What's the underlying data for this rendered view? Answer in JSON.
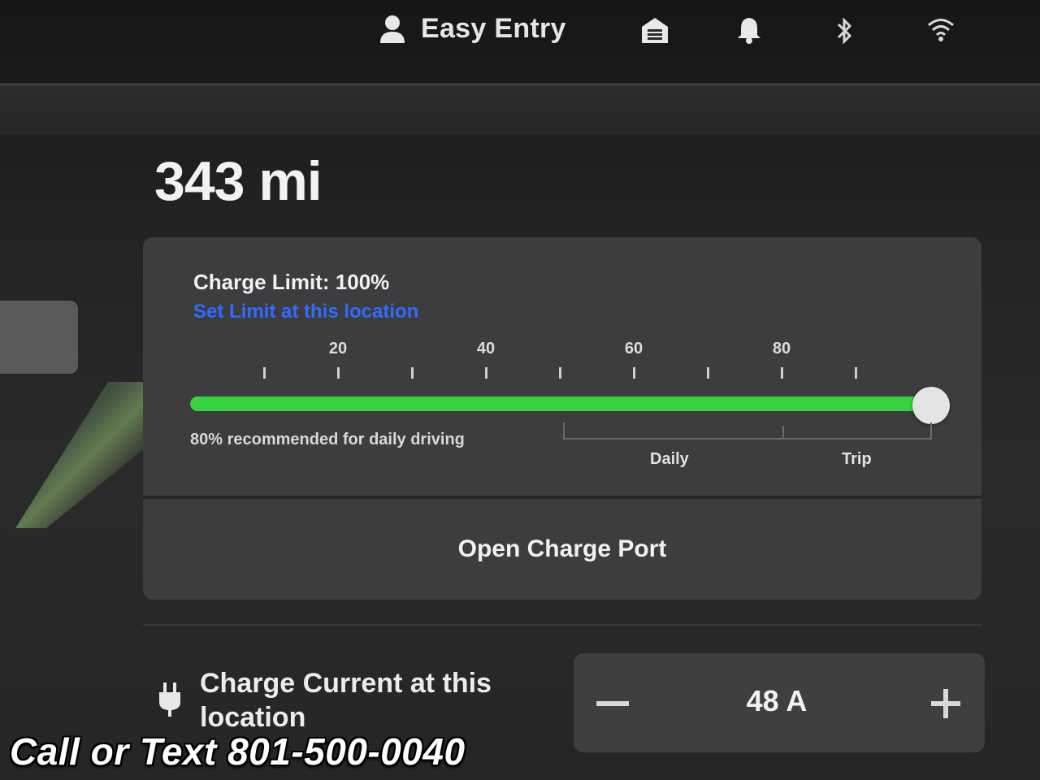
{
  "status_bar": {
    "profile_name": "Easy Entry",
    "icons": [
      "person-icon",
      "garage-icon",
      "bell-icon",
      "bluetooth-icon",
      "wifi-icon"
    ]
  },
  "range": {
    "value": "343 mi"
  },
  "charge_card": {
    "limit_label": "Charge Limit: 100%",
    "set_limit_link": "Set Limit at this location",
    "limit_percent": 100,
    "scale_labels": [
      "20",
      "40",
      "60",
      "80"
    ],
    "recommend_text": "80% recommended for daily driving",
    "zone_daily": "Daily",
    "zone_trip": "Trip",
    "open_port_label": "Open Charge Port",
    "fill_color": "#39d23f",
    "link_color": "#2f6bff"
  },
  "charge_current": {
    "label": "Charge Current at this location",
    "value": "48 A",
    "minus": "−",
    "plus": "+"
  },
  "dealer_banner": {
    "text": "Call or Text 801-500-0040"
  }
}
